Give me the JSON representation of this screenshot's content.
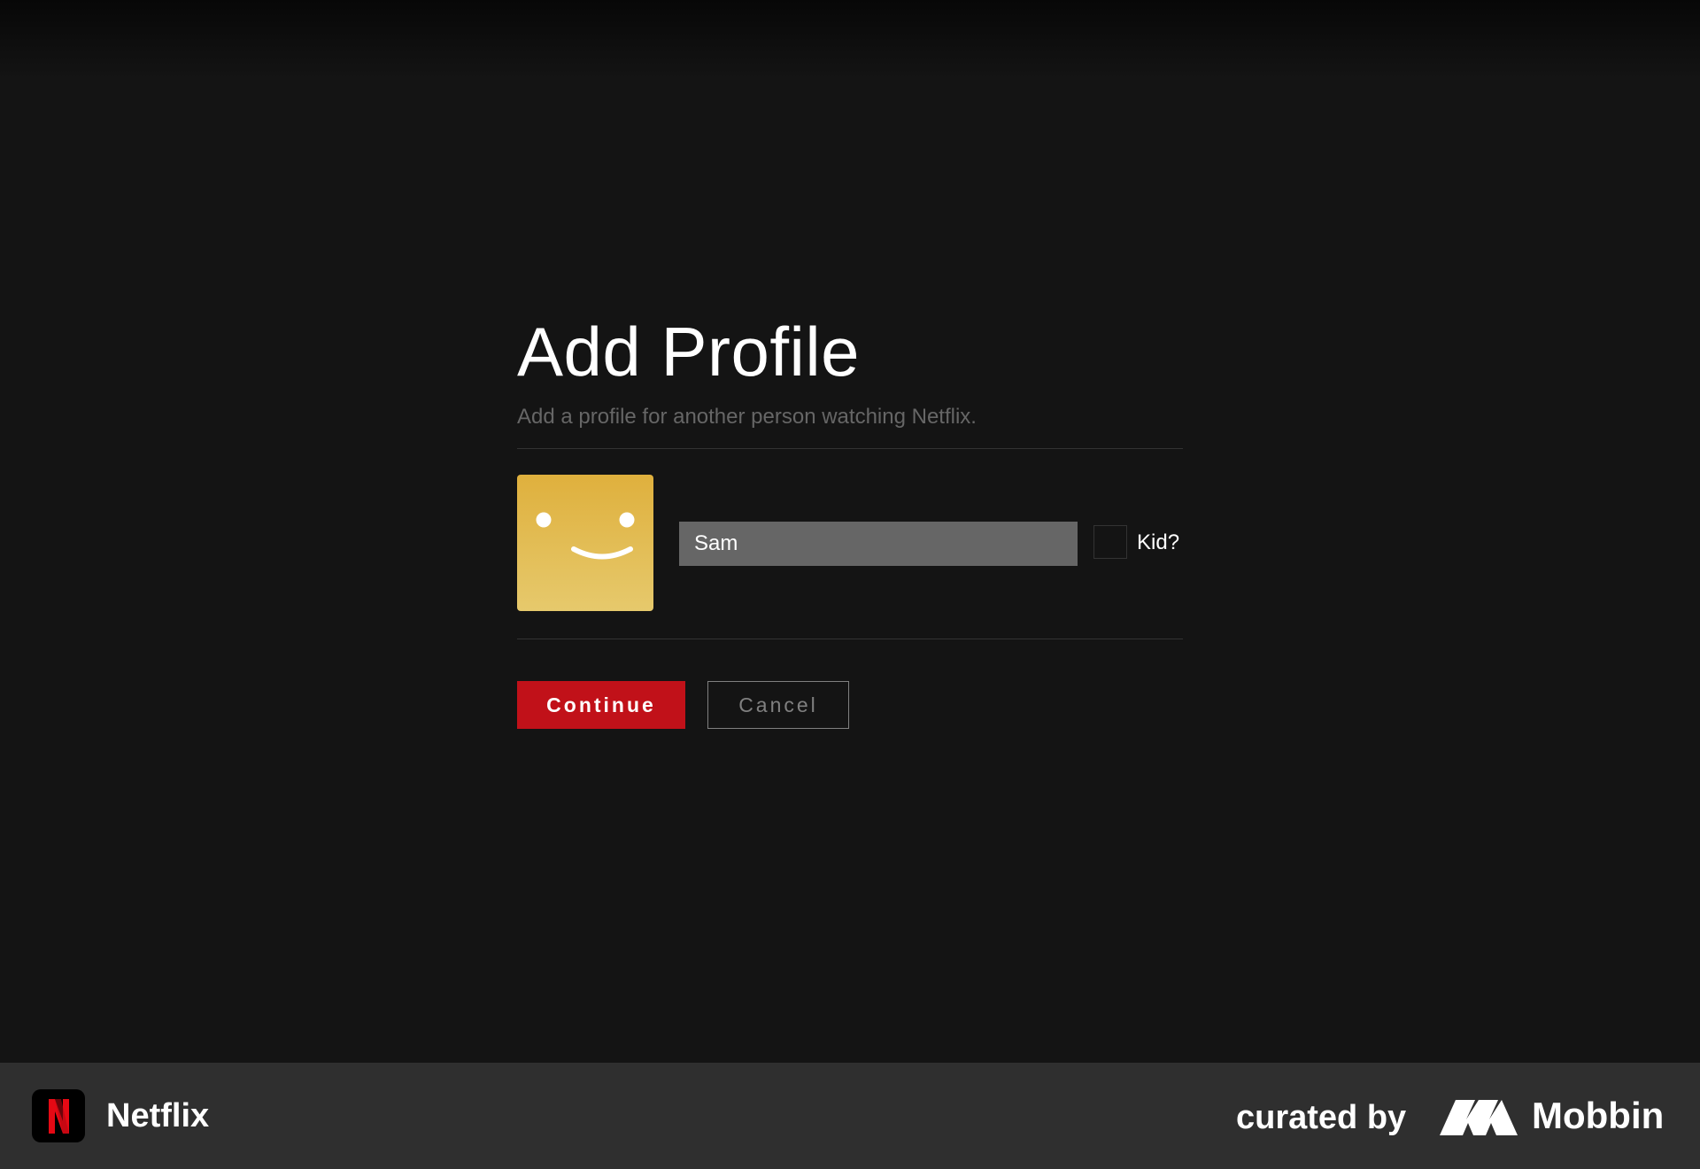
{
  "page": {
    "title": "Add Profile",
    "subtitle": "Add a profile for another person watching Netflix."
  },
  "profile": {
    "avatar_icon": "smiley-face-icon",
    "avatar_color": "#e0b43f",
    "name_value": "Sam",
    "kid_label": "Kid?",
    "kid_checked": false
  },
  "buttons": {
    "continue_label": "Continue",
    "cancel_label": "Cancel"
  },
  "colors": {
    "background": "#141414",
    "accent": "#c11119",
    "input_bg": "#666666"
  },
  "footer": {
    "app_icon": "netflix-n-icon",
    "app_name": "Netflix",
    "curated_label": "curated by",
    "brand_icon": "mobbin-logo-icon",
    "brand_name": "Mobbin"
  }
}
